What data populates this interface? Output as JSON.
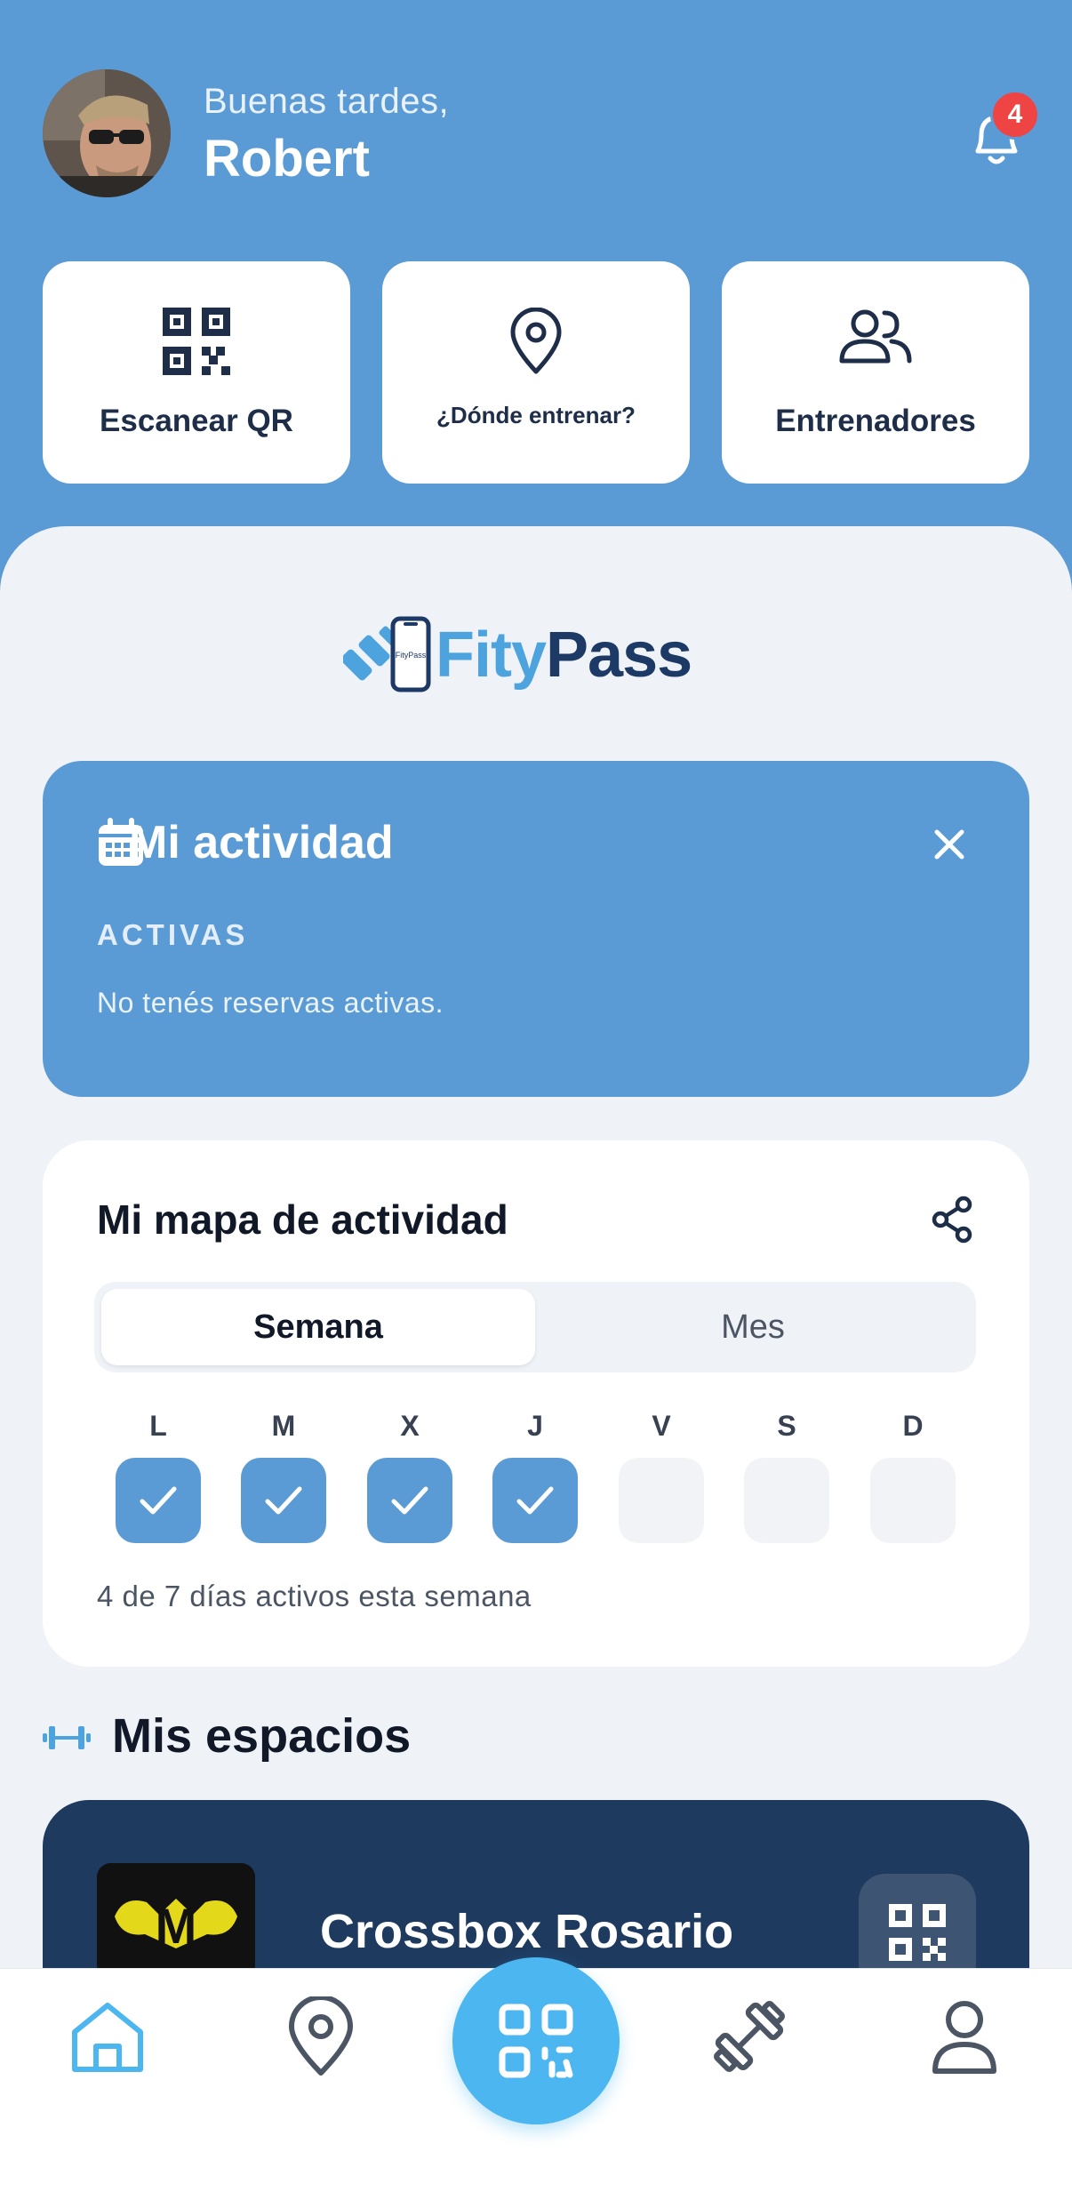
{
  "header": {
    "greeting": "Buenas tardes,",
    "user_name": "Robert",
    "notification_count": "4"
  },
  "quick_actions": [
    {
      "label": "Escanear QR",
      "icon": "qr-code-icon"
    },
    {
      "label": "¿Dónde entrenar?",
      "icon": "map-pin-icon"
    },
    {
      "label": "Entrenadores",
      "icon": "users-icon"
    }
  ],
  "brand": {
    "part1": "Fity",
    "part2": "Pass",
    "phone_text": "FityPass"
  },
  "activity": {
    "title": "Mi actividad",
    "section_label": "ACTIVAS",
    "empty_message": "No tenés reservas activas."
  },
  "activity_map": {
    "title": "Mi mapa de actividad",
    "tabs": [
      {
        "label": "Semana",
        "selected": true
      },
      {
        "label": "Mes",
        "selected": false
      }
    ],
    "days": [
      {
        "label": "L",
        "active": true
      },
      {
        "label": "M",
        "active": true
      },
      {
        "label": "X",
        "active": true
      },
      {
        "label": "J",
        "active": true
      },
      {
        "label": "V",
        "active": false
      },
      {
        "label": "S",
        "active": false
      },
      {
        "label": "D",
        "active": false
      }
    ],
    "summary": "4 de 7 días activos esta semana"
  },
  "spaces": {
    "title": "Mis espacios",
    "items": [
      {
        "name": "Crossbox Rosario",
        "logo_letter": "M"
      }
    ]
  },
  "tabbar": {
    "items": [
      "home-icon",
      "map-pin-icon",
      "qr-code-icon",
      "dumbbell-icon",
      "user-icon"
    ],
    "active": "home-icon"
  },
  "colors": {
    "primary": "#5b9bd5",
    "accent": "#4bb6ef",
    "navy": "#1e3a5f",
    "background": "#eff2f7",
    "badge": "#ef4444"
  }
}
